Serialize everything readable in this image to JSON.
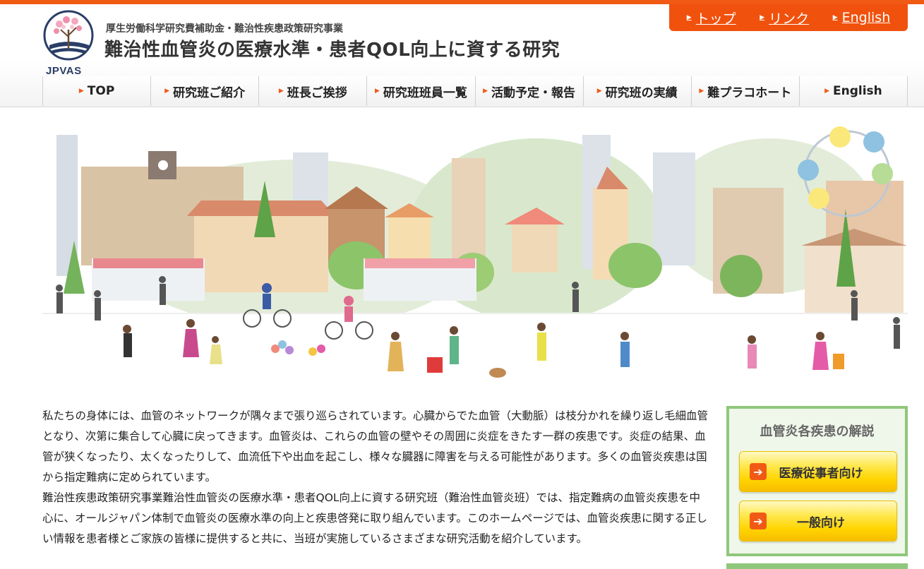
{
  "header": {
    "subtitle": "厚生労働科学研究費補助金・難治性疾患政策研究事業",
    "site_title": "難治性血管炎の医療水準・患者QOL向上に資する研究",
    "logo_text": "JPVAS"
  },
  "util_nav": [
    {
      "label": "トップ"
    },
    {
      "label": "リンク"
    },
    {
      "label": "English"
    }
  ],
  "main_nav": [
    {
      "label": "TOP"
    },
    {
      "label": "研究班ご紹介"
    },
    {
      "label": "班長ご挨拶"
    },
    {
      "label": "研究班班員一覧"
    },
    {
      "label": "活動予定・報告"
    },
    {
      "label": "研究班の実績"
    },
    {
      "label": "難プラコホート"
    },
    {
      "label": "English"
    }
  ],
  "intro": {
    "p1": "私たちの身体には、血管のネットワークが隅々まで張り巡らされています。心臓からでた血管（大動脈）は枝分かれを繰り返し毛細血管となり、次第に集合して心臓に戻ってきます。血管炎は、これらの血管の壁やその周囲に炎症をきたす一群の疾患です。炎症の結果、血管が狭くなったり、太くなったりして、血流低下や出血を起こし、様々な臓器に障害を与える可能性があります。多くの血管炎疾患は国から指定難病に定められています。",
    "p2": "難治性疾患政策研究事業難治性血管炎の医療水準・患者QOL向上に資する研究班（難治性血管炎班）では、指定難病の血管炎疾患を中心に、オールジャパン体制で血管炎の医療水準の向上と疾患啓発に取り組んでいます。このホームページでは、血管炎疾患に関する正しい情報を患者様とご家族の皆様に提供すると共に、当班が実施しているさまざまな研究活動を紹介しています。"
  },
  "sidebar": {
    "title": "血管炎各疾患の解説",
    "btn_professional": "医療従事者向け",
    "btn_general": "一般向け"
  },
  "colors": {
    "accent": "#f15a15",
    "green_border": "#8fc77b",
    "button_yellow": "#ffd400"
  }
}
